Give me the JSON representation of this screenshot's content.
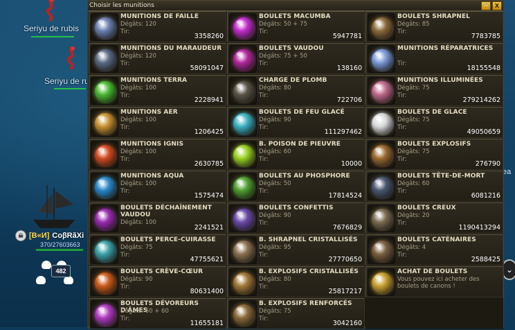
{
  "window": {
    "title": "Choisir les munitions",
    "lock_label": "🔒",
    "close_label": "X"
  },
  "game": {
    "npc_labels": [
      "Seriyu de rubis",
      "Seriyu de ru"
    ],
    "player": {
      "clan": "[B«И]",
      "name": "CoβRãXi",
      "hp_text": "370/27603663",
      "skull_count": "482"
    },
    "right_text": "ea"
  },
  "ammo": [
    {
      "name": "MUNITIONS DE FAILLE",
      "damage": "Dégâts: 120",
      "tir": "Tir:",
      "count": "3358260",
      "color": "#6a7fb0",
      "icon": "rift-ammo-icon"
    },
    {
      "name": "BOULETS MACUMBA",
      "damage": "Dégâts: 50 + 75",
      "tir": "Tir:",
      "count": "5947781",
      "color": "#c02cc8",
      "icon": "macumba-ammo-icon"
    },
    {
      "name": "BOULETS SHRAPNEL",
      "damage": "Dégâts: 85",
      "tir": "Tir:",
      "count": "7783785",
      "color": "#8a6a3a",
      "icon": "shrapnel-ammo-icon"
    },
    {
      "name": "MUNITIONS DU MARAUDEUR",
      "damage": "Dégâts: 120",
      "tir": "Tir:",
      "count": "58091047",
      "color": "#5a6a84",
      "icon": "marauder-ammo-icon"
    },
    {
      "name": "BOULETS VAUDOU",
      "damage": "Dégâts: 75 + 50",
      "tir": "Tir:",
      "count": "138160",
      "color": "#b0289a",
      "icon": "voodoo-ammo-icon"
    },
    {
      "name": "MUNITIONS RÉPARATRICES",
      "damage": "",
      "tir": "Tir:",
      "count": "18155548",
      "color": "#7a9ad8",
      "icon": "repair-ammo-icon"
    },
    {
      "name": "MUNITIONS TERRA",
      "damage": "Dégâts: 100",
      "tir": "Tir:",
      "count": "2228941",
      "color": "#48b830",
      "icon": "terra-ammo-icon"
    },
    {
      "name": "CHARGE DE PLOMB",
      "damage": "Dégâts: 80",
      "tir": "Tir:",
      "count": "722706",
      "color": "#5c5448",
      "icon": "lead-charge-icon"
    },
    {
      "name": "MUNITIONS ILLUMINÉES",
      "damage": "Dégâts: 75",
      "tir": "Tir:",
      "count": "279214262",
      "color": "#c06a8a",
      "icon": "illuminated-ammo-icon"
    },
    {
      "name": "MUNITIONS AER",
      "damage": "Dégâts: 100",
      "tir": "Tir:",
      "count": "1206425",
      "color": "#c89030",
      "icon": "aer-ammo-icon"
    },
    {
      "name": "BOULETS DE FEU GLACÉ",
      "damage": "Dégâts: 90",
      "tir": "Tir:",
      "count": "111297462",
      "color": "#3ab0c0",
      "icon": "frostfire-ammo-icon"
    },
    {
      "name": "BOULETS DE GLACE",
      "damage": "Dégâts: 75",
      "tir": "Tir:",
      "count": "49050659",
      "color": "#d8d8d8",
      "icon": "ice-ammo-icon"
    },
    {
      "name": "MUNITIONS IGNIS",
      "damage": "Dégâts: 100",
      "tir": "Tir:",
      "count": "2630785",
      "color": "#d04a20",
      "icon": "ignis-ammo-icon"
    },
    {
      "name": "B. POISON DE PIEUVRE",
      "damage": "Dégâts: 60",
      "tir": "Tir:",
      "count": "10000",
      "color": "#98d020",
      "icon": "octopus-poison-icon"
    },
    {
      "name": "BOULETS EXPLOSIFS",
      "damage": "Dégâts: 75",
      "tir": "Tir:",
      "count": "276790",
      "color": "#9a6a30",
      "icon": "explosive-ammo-icon"
    },
    {
      "name": "MUNITIONS AQUA",
      "damage": "Dégâts: 100",
      "tir": "Tir:",
      "count": "1575474",
      "color": "#2a88c8",
      "icon": "aqua-ammo-icon"
    },
    {
      "name": "BOULETS AU PHOSPHORE",
      "damage": "Dégâts: 50",
      "tir": "Tir:",
      "count": "17814524",
      "color": "#50a030",
      "icon": "phosphorus-ammo-icon"
    },
    {
      "name": "BOULETS TÊTE-DE-MORT",
      "damage": "Dégâts: 60",
      "tir": "Tir:",
      "count": "6081216",
      "color": "#4a5870",
      "icon": "skull-ammo-icon"
    },
    {
      "name": "BOULETS DÉCHAÎNEMENT VAUDOU",
      "damage": "Dégâts: 100",
      "tir": "Tir:",
      "count": "2241521",
      "color": "#9a2ab0",
      "icon": "voodoo-fury-icon"
    },
    {
      "name": "BOULETS CONFETTIS",
      "damage": "Dégâts: 90",
      "tir": "Tir:",
      "count": "7676829",
      "color": "#6a4aa8",
      "icon": "confetti-ammo-icon"
    },
    {
      "name": "BOULETS CREUX",
      "damage": "Dégâts: 20",
      "tir": "Tir:",
      "count": "1190413294",
      "color": "#7a6a50",
      "icon": "hollow-ammo-icon"
    },
    {
      "name": "BOULETS PERCE-CUIRASSE",
      "damage": "Dégâts: 75",
      "tir": "Tir:",
      "count": "47755621",
      "color": "#3aa0a8",
      "icon": "armor-piercing-icon"
    },
    {
      "name": "B. SHRAPNEL CRISTALLISÉS",
      "damage": "Dégâts: 95",
      "tir": "Tir:",
      "count": "27770650",
      "color": "#8a7050",
      "icon": "crystal-shrapnel-icon"
    },
    {
      "name": "BOULETS CATÉNAIRES",
      "damage": "Dégâts: 4",
      "tir": "Tir:",
      "count": "2588425",
      "color": "#7a6040",
      "icon": "chain-shot-icon"
    },
    {
      "name": "BOULETS CRÈVE-CŒUR",
      "damage": "Dégâts: 90",
      "tir": "Tir:",
      "count": "80631400",
      "color": "#c85a18",
      "icon": "heartbreaker-ammo-icon"
    },
    {
      "name": "B. EXPLOSIFS CRISTALLISÉS",
      "damage": "Dégâts: 80",
      "tir": "Tir:",
      "count": "25817217",
      "color": "#a07838",
      "icon": "crystal-explosive-icon"
    },
    {
      "name": "ACHAT DE BOULETS",
      "desc": "Vous pouvez ici acheter des boulets de canons !",
      "color": "#c8a030",
      "icon": "cannon-shop-icon",
      "shop": true
    },
    {
      "name": "BOULETS DÉVOREURS D'ÂMES",
      "damage": "Dégâts: 60 + 60",
      "tir": "Tir:",
      "count": "11655181",
      "color": "#b03ac0",
      "icon": "soul-devourer-icon"
    },
    {
      "name": "B. EXPLOSIFS RENFORCÉS",
      "damage": "Dégâts: 75",
      "tir": "Tir:",
      "count": "3042160",
      "color": "#8a6a38",
      "icon": "reinforced-explosive-icon"
    }
  ]
}
